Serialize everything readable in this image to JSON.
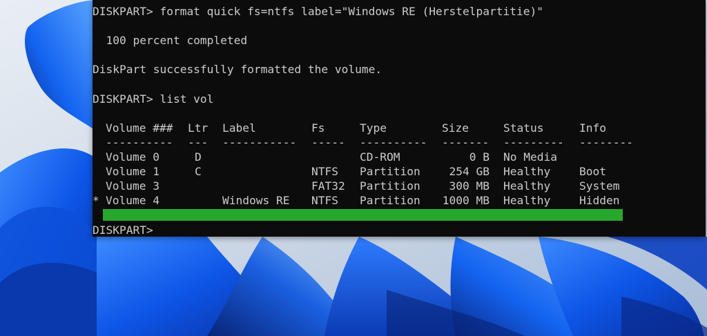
{
  "terminal": {
    "command1": "DISKPART> format quick fs=ntfs label=\"Windows RE (Herstelpartitie)\"",
    "progress": "  100 percent completed",
    "success": "DiskPart successfully formatted the volume.",
    "command2": "DISKPART> list vol",
    "prompt": "DISKPART> "
  },
  "volume_table": {
    "headers": [
      "Volume ###",
      "Ltr",
      "Label",
      "Fs",
      "Type",
      "Size",
      "Status",
      "Info"
    ],
    "separators": [
      "----------",
      "---",
      "-----------",
      "-----",
      "----------",
      "-------",
      "---------",
      "--------"
    ],
    "rows": [
      {
        "marker": "",
        "volume": "Volume 0",
        "ltr": "D",
        "label": "",
        "fs": "",
        "type": "CD-ROM",
        "size": "0 B",
        "status": "No Media",
        "info": ""
      },
      {
        "marker": "",
        "volume": "Volume 1",
        "ltr": "C",
        "label": "",
        "fs": "NTFS",
        "type": "Partition",
        "size": "254 GB",
        "status": "Healthy",
        "info": "Boot"
      },
      {
        "marker": "",
        "volume": "Volume 3",
        "ltr": "",
        "label": "",
        "fs": "FAT32",
        "type": "Partition",
        "size": "300 MB",
        "status": "Healthy",
        "info": "System"
      },
      {
        "marker": "*",
        "volume": "Volume 4",
        "ltr": "",
        "label": "Windows RE",
        "fs": "NTFS",
        "type": "Partition",
        "size": "1000 MB",
        "status": "Healthy",
        "info": "Hidden"
      }
    ]
  },
  "colors": {
    "terminal_bg": "#0c0c0c",
    "terminal_text": "#cccccc",
    "highlight": "#27a82c",
    "wallpaper_blue": "#1a5fe0"
  }
}
